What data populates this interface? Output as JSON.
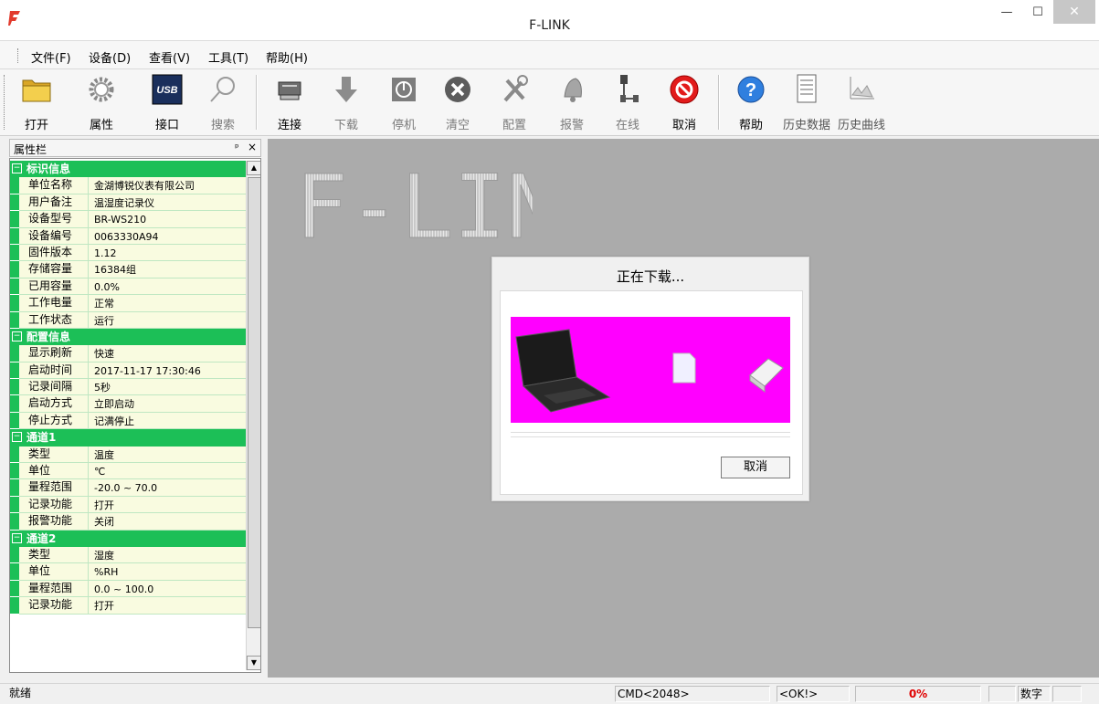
{
  "window": {
    "title": "F-LINK"
  },
  "menu": [
    "文件(F)",
    "设备(D)",
    "查看(V)",
    "工具(T)",
    "帮助(H)"
  ],
  "toolbar": {
    "open": "打开",
    "properties": "属性",
    "interface": "接口",
    "search": "搜索",
    "connect": "连接",
    "download": "下载",
    "stop": "停机",
    "clear": "清空",
    "configure": "配置",
    "alarm": "报警",
    "online": "在线",
    "cancel": "取消",
    "help": "帮助",
    "history_data": "历史数据",
    "history_curve": "历史曲线",
    "usb_badge": "USB"
  },
  "property_panel": {
    "title": "属性栏",
    "pin": "ᵖ",
    "close": "×",
    "sections": [
      {
        "name": "标识信息",
        "rows": [
          [
            "单位名称",
            "金湖博锐仪表有限公司"
          ],
          [
            "用户备注",
            "温湿度记录仪"
          ],
          [
            "设备型号",
            "BR-WS210"
          ],
          [
            "设备编号",
            "0063330A94"
          ],
          [
            "固件版本",
            "1.12"
          ],
          [
            "存储容量",
            "16384组"
          ],
          [
            "已用容量",
            "0.0%"
          ],
          [
            "工作电量",
            "正常"
          ],
          [
            "工作状态",
            "运行"
          ]
        ]
      },
      {
        "name": "配置信息",
        "rows": [
          [
            "显示刷新",
            "快速"
          ],
          [
            "启动时间",
            "2017-11-17 17:30:46"
          ],
          [
            "记录间隔",
            "5秒"
          ],
          [
            "启动方式",
            "立即启动"
          ],
          [
            "停止方式",
            "记满停止"
          ]
        ]
      },
      {
        "name": "通道1",
        "rows": [
          [
            "类型",
            "温度"
          ],
          [
            "单位",
            "℃"
          ],
          [
            "量程范围",
            "-20.0 ~ 70.0"
          ],
          [
            "记录功能",
            "打开"
          ],
          [
            "报警功能",
            "关闭"
          ]
        ]
      },
      {
        "name": "通道2",
        "rows": [
          [
            "类型",
            "湿度"
          ],
          [
            "单位",
            "%RH"
          ],
          [
            "量程范围",
            "0.0 ~ 100.0"
          ],
          [
            "记录功能",
            "打开"
          ]
        ]
      }
    ]
  },
  "main": {
    "logo_text": "F-LINK"
  },
  "dialog": {
    "title": "正在下载...",
    "cancel_label": "取消",
    "progress": 0
  },
  "statusbar": {
    "ready": "就绪",
    "cmd": "CMD<2048>",
    "ok": "<OK!>",
    "percent": "0%",
    "num": "数字"
  },
  "colors": {
    "category_green": "#1cbf57",
    "row_bg": "#f9fbe0",
    "workspace": "#ababab",
    "animation_bg": "#ff00ff",
    "percent_red": "#e00000"
  }
}
